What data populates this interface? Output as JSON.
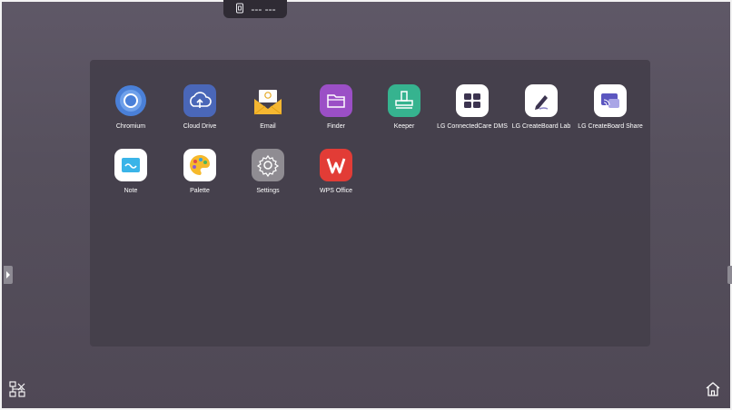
{
  "status_bar": {
    "indicator_text": "--- ---",
    "icon": "storage-icon"
  },
  "apps": [
    {
      "label": "Chromium",
      "icon": "chromium-icon"
    },
    {
      "label": "Cloud Drive",
      "icon": "cloud-drive-icon"
    },
    {
      "label": "Email",
      "icon": "email-icon"
    },
    {
      "label": "Finder",
      "icon": "folder-icon"
    },
    {
      "label": "Keeper",
      "icon": "keeper-icon"
    },
    {
      "label": "LG ConnectedCare DMS",
      "icon": "dashboard-icon"
    },
    {
      "label": "LG CreateBoard Lab",
      "icon": "pen-icon"
    },
    {
      "label": "LG CreateBoard Share",
      "icon": "screen-share-icon"
    },
    {
      "label": "Note",
      "icon": "note-icon"
    },
    {
      "label": "Palette",
      "icon": "palette-icon"
    },
    {
      "label": "Settings",
      "icon": "gear-icon"
    },
    {
      "label": "WPS Office",
      "icon": "wps-icon"
    }
  ],
  "side_handles": {
    "left": "chevron-right-icon",
    "right": "chevron-left-icon"
  },
  "bottom_bar": {
    "left_icon": "network-icon",
    "right_icon": "home-icon"
  }
}
